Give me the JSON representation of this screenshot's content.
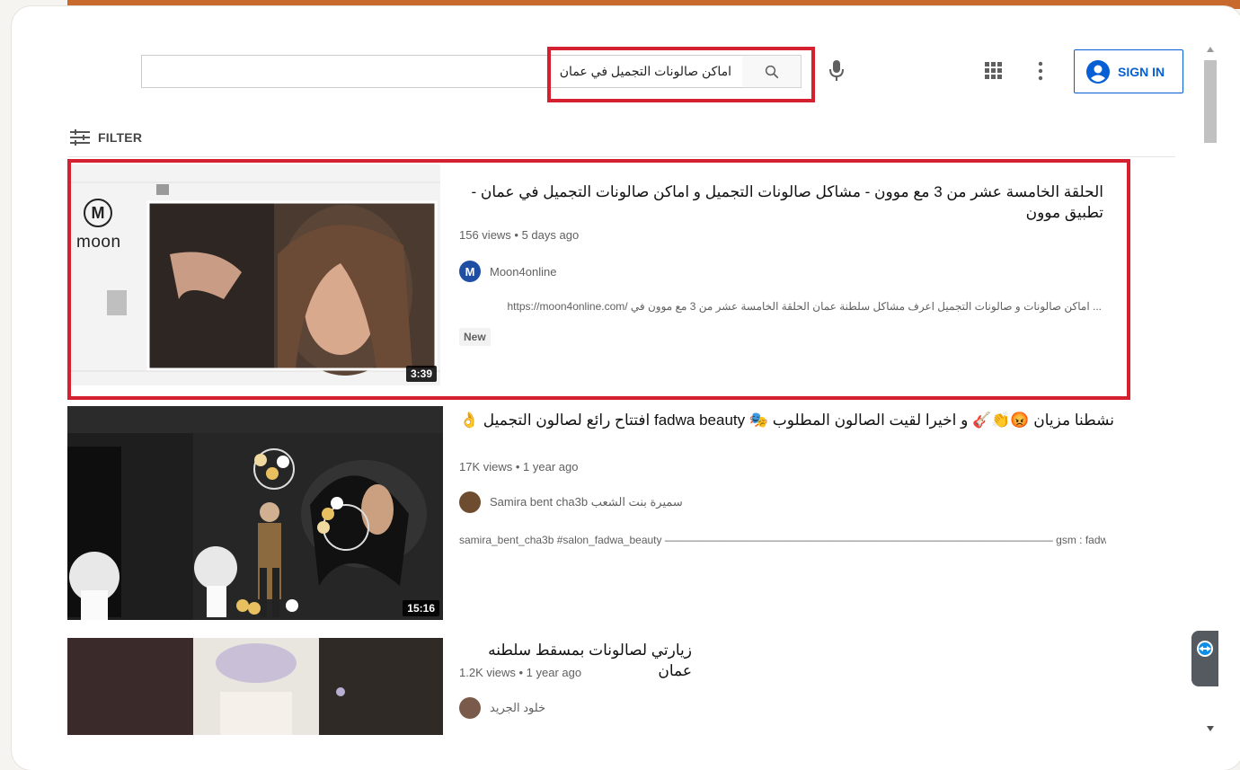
{
  "search": {
    "query": "اماكن صالونات التجميل في عمان"
  },
  "header": {
    "sign_in_label": "SIGN IN"
  },
  "filter": {
    "label": "FILTER"
  },
  "videos": [
    {
      "title": "الحلقة الخامسة عشر من 3 مع موون - مشاكل صالونات التجميل و اماكن صالونات التجميل في عمان - تطبيق موون",
      "meta": "156 views • 5 days ago",
      "channel": "Moon4online",
      "description": "... اماكن صالونات و صالونات التجميل اعرف مشاكل سلطنة عمان الحلقة الخامسة عشر من 3 مع موون في /https://moon4online.com",
      "badge": "New",
      "duration": "3:39",
      "logo_letter": "M",
      "logo_word": "moon"
    },
    {
      "title": "نشطنا مزيان 😡👏🎸 و اخيرا لقيت الصالون المطلوب 🎭 fadwa beauty افتتاح رائع لصالون التجميل 👌",
      "meta": "17K views • 1 year ago",
      "channel": "Samira bent cha3b سميرة بنت الشعب",
      "description": "samira_bent_cha3b #salon_fadwa_beauty ———————————————————————————————————— gsm : fadwa beauty ...",
      "duration": "15:16"
    },
    {
      "title": "زيارتي لصالونات بمسقط سلطنه عمان",
      "meta": "1.2K views • 1 year ago",
      "channel": "خلود الجريد"
    }
  ],
  "colors": {
    "accent_red": "#d4202f",
    "link_blue": "#065fd4",
    "top_bar": "#c8692e"
  }
}
